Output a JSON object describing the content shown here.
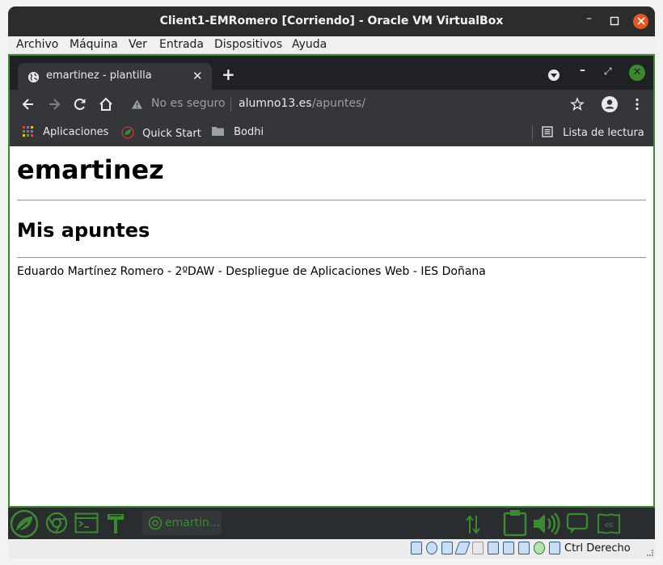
{
  "vbox": {
    "title": "Client1-EMRomero [Corriendo] - Oracle VM VirtualBox",
    "menu": [
      "Archivo",
      "Máquina",
      "Ver",
      "Entrada",
      "Dispositivos",
      "Ayuda"
    ],
    "host_key": "Ctrl Derecho"
  },
  "browser": {
    "tab": {
      "title": "emartinez - plantilla"
    },
    "omnibox": {
      "security_label": "No es seguro",
      "host": "alumno13.es",
      "path": "/apuntes/"
    },
    "bookmarks": {
      "apps": "Aplicaciones",
      "quick_start": "Quick Start",
      "folder": "Bodhi",
      "reading_list": "Lista de lectura"
    }
  },
  "page": {
    "heading": "emartinez",
    "subheading": "Mis apuntes",
    "footer": "Eduardo Martínez Romero - 2ºDAW - Despliegue de Aplicaciones Web - IES Doñana"
  },
  "dock": {
    "task_label": "emartin..."
  },
  "icons": {
    "accent": "#3c8a2e",
    "dock_icons": [
      "bodhi-leaf-icon",
      "chrome-icon",
      "terminal-icon",
      "network-tools-icon"
    ],
    "tray_icons": [
      "network-arrows-icon",
      "clipboard-icon",
      "volume-icon",
      "chat-icon",
      "keyboard-layout-icon"
    ],
    "tray_keyboard_label": "es"
  }
}
